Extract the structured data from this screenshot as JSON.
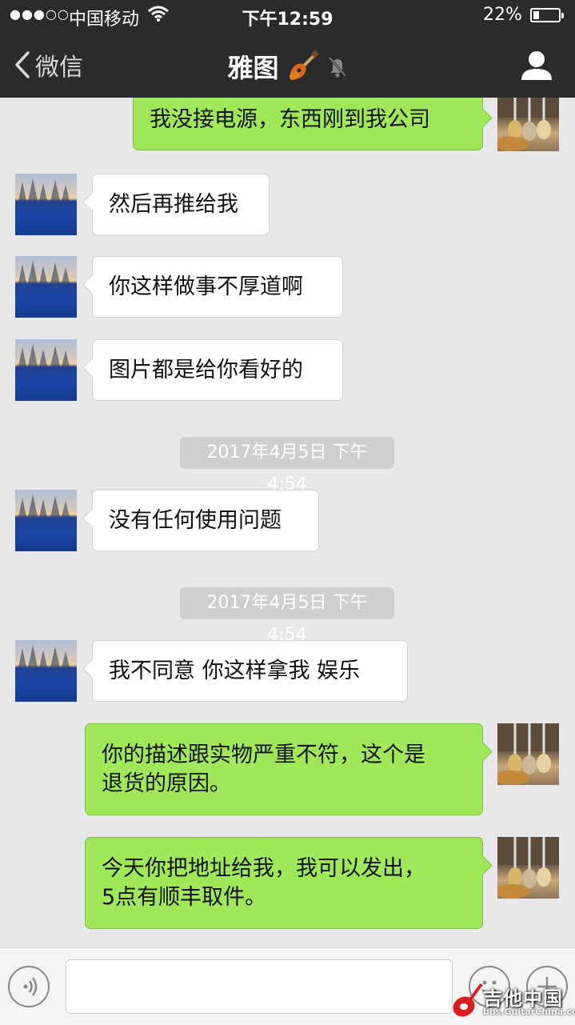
{
  "status_bar": {
    "signal": "●●●○○",
    "carrier": "中国移动",
    "time": "下午12:59",
    "battery_percent": "22%",
    "battery_level": 0.22
  },
  "nav": {
    "back_label": "微信",
    "title": "雅图",
    "icons": [
      "chevron-left-icon",
      "guitar-emoji-icon",
      "muted-bell-icon",
      "profile-icon"
    ]
  },
  "messages": [
    {
      "side": "out",
      "text": "我没接电源，东西刚到我公司"
    },
    {
      "side": "in",
      "text": "然后再推给我"
    },
    {
      "side": "in",
      "text": "你这样做事不厚道啊"
    },
    {
      "side": "in",
      "text": "图片都是给你看好的"
    },
    {
      "type": "time",
      "text": "2017年4月5日  下午4:54"
    },
    {
      "side": "in",
      "text": "没有任何使用问题"
    },
    {
      "type": "time",
      "text": "2017年4月5日  下午4:54"
    },
    {
      "side": "in",
      "text": "我不同意 你这样拿我 娱乐"
    },
    {
      "side": "out",
      "lines": [
        "你的描述跟实物严重不符，这个是",
        "退货的原因。"
      ]
    },
    {
      "side": "out",
      "lines": [
        "今天你把地址给我，我可以发出，",
        "5点有顺丰取件。"
      ]
    }
  ],
  "input_bar": {
    "icons": [
      "voice-icon",
      "emoji-icon",
      "plus-icon"
    ]
  },
  "watermark": {
    "text": "吉他中国",
    "url": "bbs.GuitarChina.com"
  },
  "colors": {
    "nav_bg": "#2b2b2e",
    "chat_bg": "#e8e8ea",
    "outgoing_bubble": "#a0e75a",
    "incoming_bubble": "#ffffff",
    "timestamp_bg": "#cfcfd1"
  }
}
